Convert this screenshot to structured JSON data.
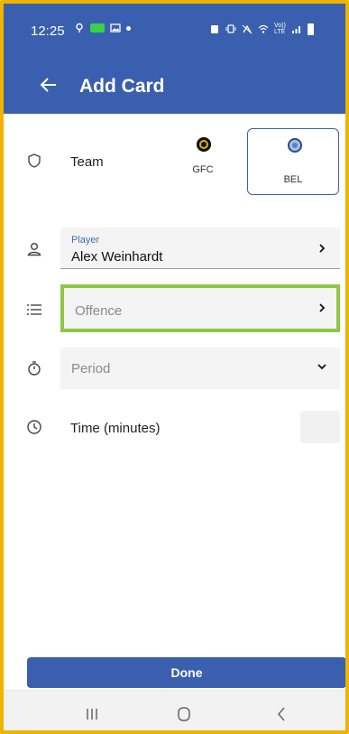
{
  "status_bar": {
    "time": "12:25",
    "network_label_top": "Vo))",
    "network_label_bottom": "LTE"
  },
  "app_bar": {
    "title": "Add Card",
    "back_icon": "arrow-left-icon"
  },
  "team": {
    "label": "Team",
    "options": [
      {
        "abbr": "GFC",
        "selected": false
      },
      {
        "abbr": "BEL",
        "selected": true
      }
    ]
  },
  "player": {
    "label": "Player",
    "value": "Alex Weinhardt"
  },
  "offence": {
    "placeholder": "Offence"
  },
  "period": {
    "placeholder": "Period"
  },
  "time": {
    "label": "Time (minutes)",
    "value": ""
  },
  "done_button": {
    "label": "Done"
  },
  "colors": {
    "primary": "#3a5fae",
    "highlight": "#8dc845",
    "frame": "#f0b400"
  }
}
